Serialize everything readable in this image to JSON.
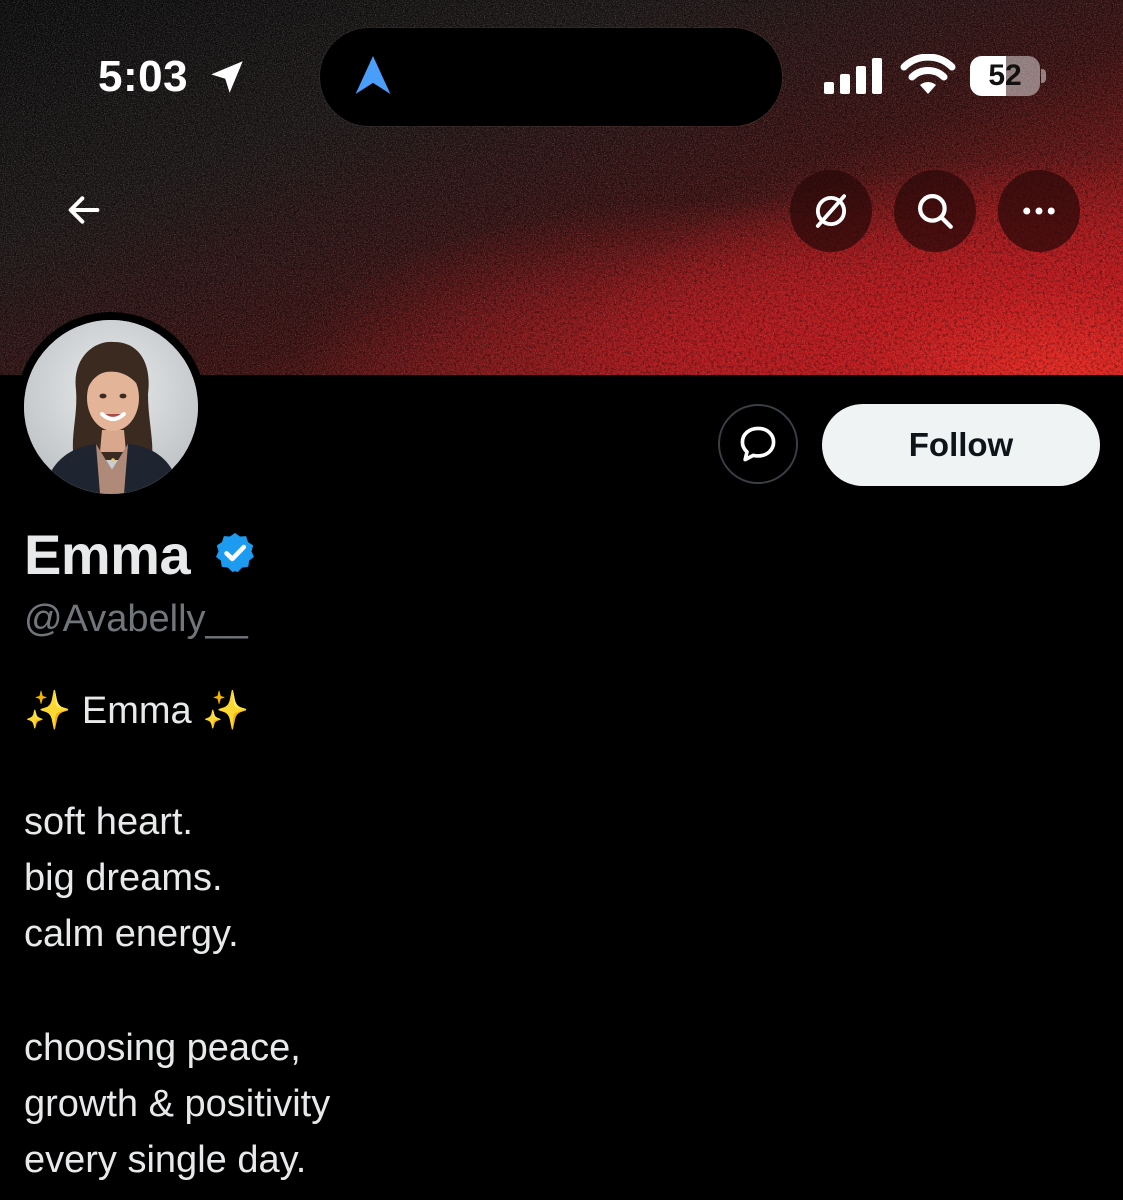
{
  "status_bar": {
    "time": "5:03",
    "battery_level": "52",
    "battery_fraction": 0.52
  },
  "icons": {
    "location": "location-arrow-icon",
    "navigation": "navigation-arrow-icon",
    "signal": "cellular-signal-icon",
    "wifi": "wifi-icon",
    "back": "back-arrow-icon",
    "grok": "grok-icon",
    "search": "search-icon",
    "more": "more-icon",
    "message": "message-icon",
    "verified": "verified-badge-icon"
  },
  "colors": {
    "background": "#000000",
    "verified_blue": "#1d9bf0",
    "banner_red": "#d8201e",
    "follow_bg": "#eff3f4",
    "handle_gray": "#71767b"
  },
  "profile": {
    "display_name": "Emma",
    "handle": "@Avabelly__",
    "follow_label": "Follow",
    "bio": {
      "title_sparkle_left": "✨",
      "title": "Emma",
      "title_sparkle_right": "✨",
      "lines": [
        "soft heart.",
        "big dreams.",
        "calm energy.",
        "choosing peace,",
        "growth & positivity",
        "every single day."
      ]
    }
  }
}
